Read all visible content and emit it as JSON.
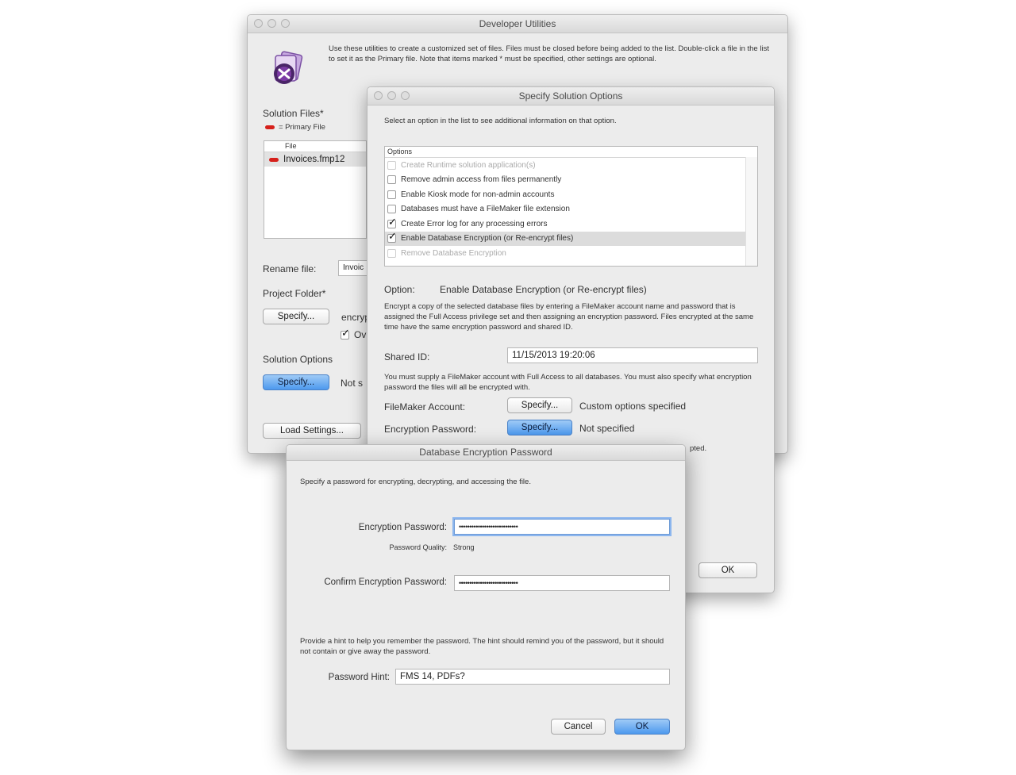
{
  "dev_utilities": {
    "title": "Developer Utilities",
    "description": "Use these utilities to create a customized set of files. Files must be closed before being added to the list. Double-click a file in the list to set it as the Primary file. Note that items marked * must be specified, other settings are optional.",
    "solution_files_label": "Solution Files*",
    "primary_file_legend": "= Primary File",
    "file_column_header": "File",
    "files": [
      "Invoices.fmp12"
    ],
    "rename_file_label": "Rename file:",
    "rename_file_value": "Invoic",
    "project_folder_label": "Project Folder*",
    "specify_label": "Specify...",
    "encrypt_partial": "encryp",
    "overwrite_partial": "Ov",
    "solution_options_label": "Solution Options",
    "solution_specify_label": "Specify...",
    "not_specified_partial": "Not s",
    "load_settings_label": "Load Settings..."
  },
  "solution_options": {
    "title": "Specify Solution Options",
    "instruction": "Select an option in the list to see additional information on that option.",
    "options_header": "Options",
    "options": [
      {
        "label": "Create Runtime solution application(s)",
        "checked": false,
        "enabled": false
      },
      {
        "label": "Remove admin access from files permanently",
        "checked": false,
        "enabled": true
      },
      {
        "label": "Enable Kiosk mode for non-admin accounts",
        "checked": false,
        "enabled": true
      },
      {
        "label": "Databases must have a FileMaker file extension",
        "checked": false,
        "enabled": true
      },
      {
        "label": "Create Error log for any processing errors",
        "checked": true,
        "enabled": true
      },
      {
        "label": "Enable Database Encryption (or Re-encrypt files)",
        "checked": true,
        "enabled": true,
        "selected": true
      },
      {
        "label": "Remove Database Encryption",
        "checked": false,
        "enabled": false
      }
    ],
    "option_label": "Option:",
    "option_value": "Enable Database Encryption (or Re-encrypt files)",
    "option_description": "Encrypt a copy of the selected database files by entering a FileMaker account name and password that is assigned the Full Access privilege set and then assigning an encryption password. Files encrypted at the same time have the same encryption password and shared ID.",
    "shared_id_label": "Shared ID:",
    "shared_id_value": "11/15/2013 19:20:06",
    "account_note": "You must supply a FileMaker account with Full Access to all databases. You must also specify what encryption password the files will all be encrypted with.",
    "filemaker_account_label": "FileMaker Account:",
    "account_specify_label": "Specify...",
    "account_status": "Custom options specified",
    "encryption_password_label": "Encryption Password:",
    "password_specify_label": "Specify...",
    "password_status": "Not specified",
    "hidden_partial": "pted.",
    "ok_label": "OK"
  },
  "encryption_dialog": {
    "title": "Database Encryption Password",
    "instruction": "Specify a password for encrypting, decrypting, and accessing the file.",
    "encryption_password_label": "Encryption Password:",
    "encryption_password_value": "••••••••••••••••••••••••••••",
    "password_quality_label": "Password Quality:",
    "password_quality_value": "Strong",
    "confirm_label": "Confirm Encryption Password:",
    "confirm_value": "••••••••••••••••••••••••••••",
    "hint_instruction": "Provide a hint to help you remember the password. The hint should remind you of the password, but it should not contain or give away the password.",
    "hint_label": "Password Hint:",
    "hint_value": "FMS 14, PDFs?",
    "cancel_label": "Cancel",
    "ok_label": "OK"
  }
}
